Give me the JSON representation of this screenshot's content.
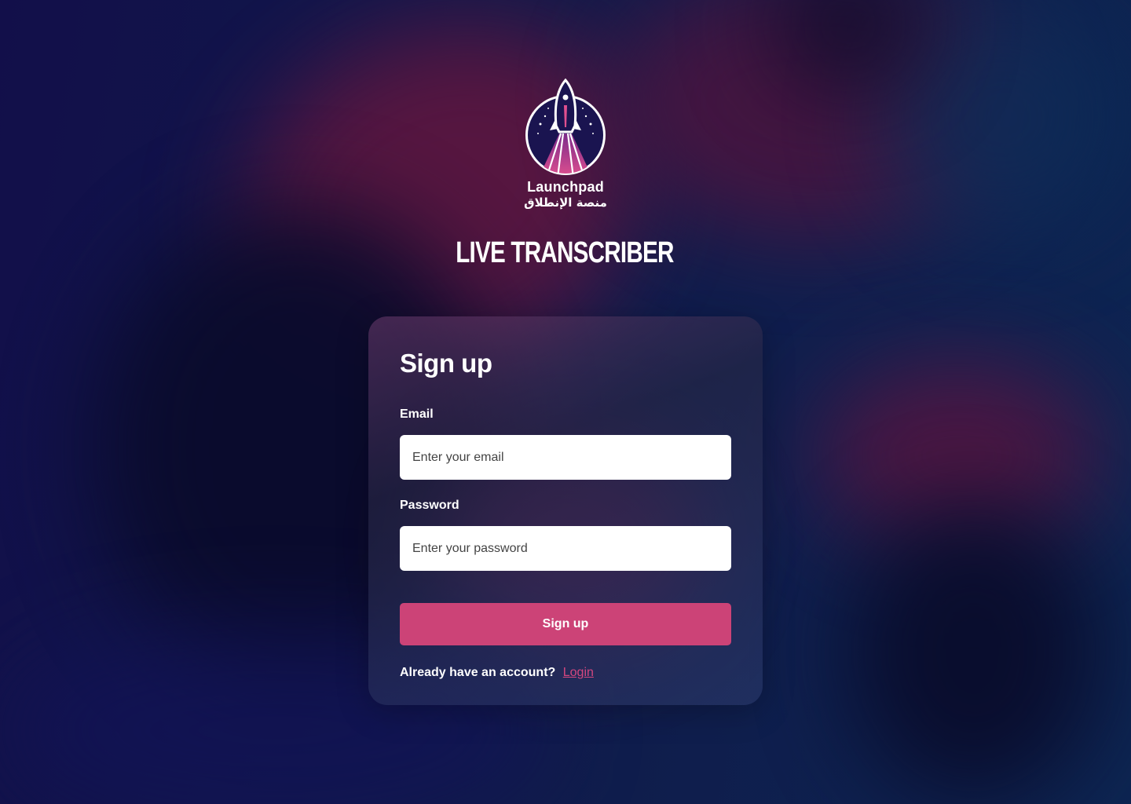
{
  "brand": {
    "name": "Launchpad",
    "name_arabic": "منصة الإنطلاق",
    "logo_icon": "rocket-logo-icon"
  },
  "app": {
    "title": "LIVE TRANSCRIBER"
  },
  "form": {
    "title": "Sign up",
    "email": {
      "label": "Email",
      "placeholder": "Enter your email",
      "value": ""
    },
    "password": {
      "label": "Password",
      "placeholder": "Enter your password",
      "value": ""
    },
    "submit_label": "Sign up",
    "login_prompt": "Already have an account?",
    "login_link": "Login"
  },
  "colors": {
    "accent": "#cc4377",
    "link": "#d4477f",
    "background_dark": "#0f1445"
  }
}
